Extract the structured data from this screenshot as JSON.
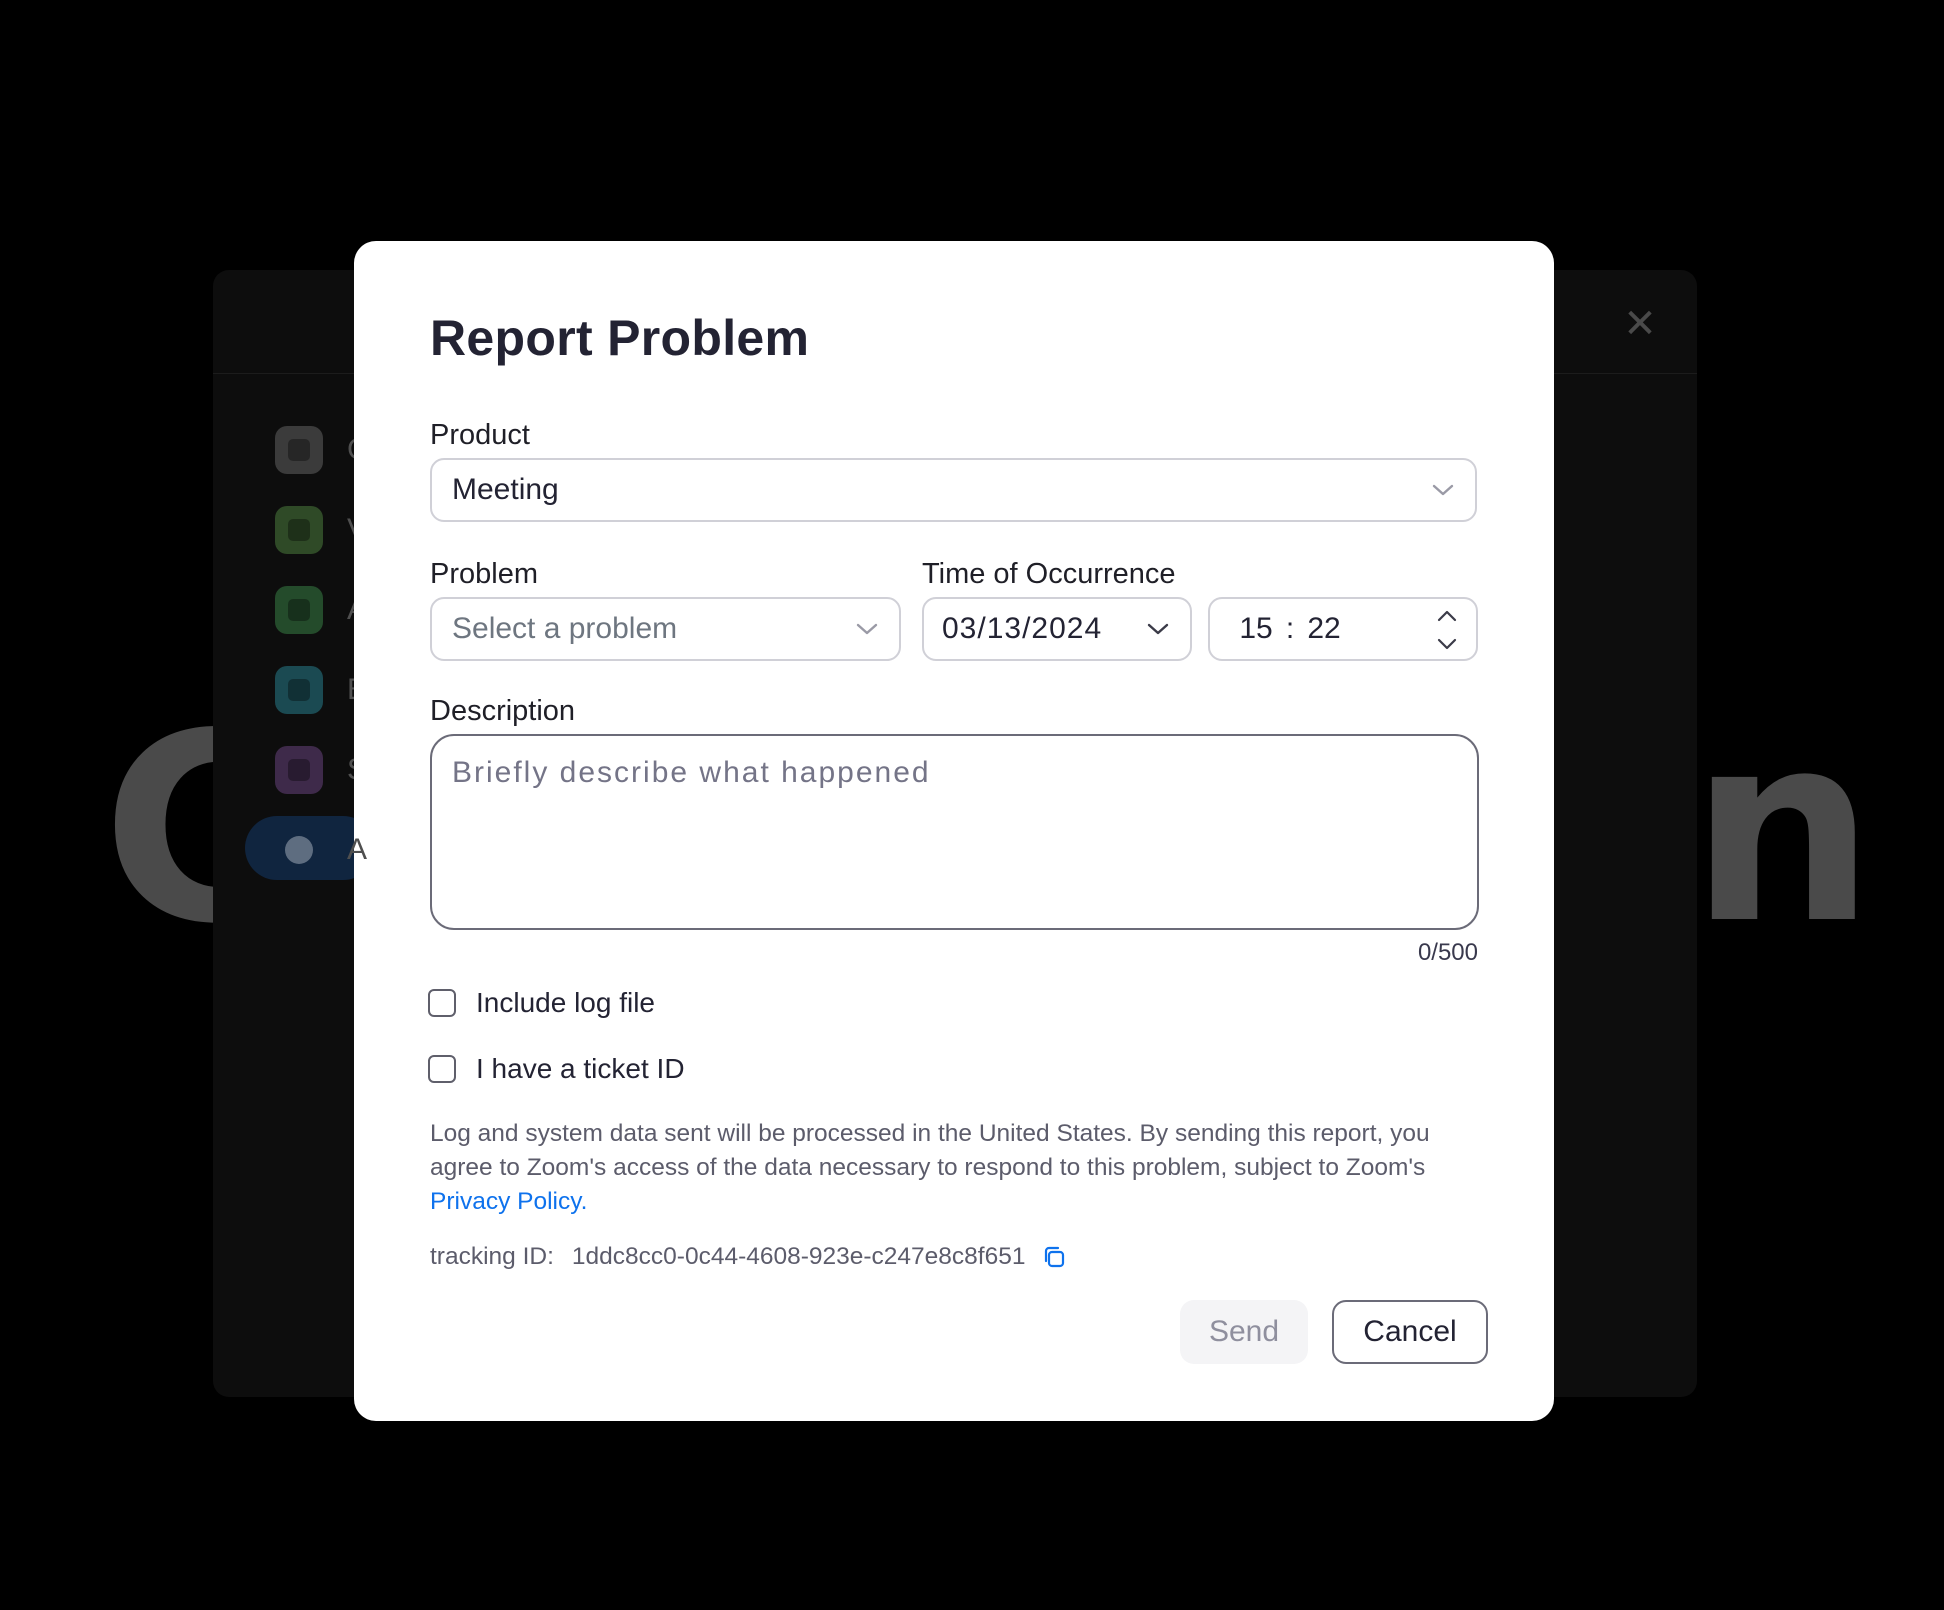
{
  "background": {
    "big_text_left": "C",
    "big_text_right": "n",
    "nav_items": [
      {
        "label": "G",
        "icon": "gear-icon",
        "color": "#3b3b3b"
      },
      {
        "label": "V",
        "icon": "video-icon",
        "color": "#2f4a27"
      },
      {
        "label": "A",
        "icon": "headphones-icon",
        "color": "#244b2b"
      },
      {
        "label": "B",
        "icon": "background-icon",
        "color": "#1b4a52"
      },
      {
        "label": "S",
        "icon": "statistics-icon",
        "color": "#3e2a4a"
      },
      {
        "label": "A",
        "icon": "info-icon",
        "color": "#10253f"
      }
    ],
    "close_icon": "close-icon"
  },
  "dialog": {
    "title": "Report Problem",
    "product": {
      "label": "Product",
      "value": "Meeting"
    },
    "problem": {
      "label": "Problem",
      "placeholder": "Select a problem"
    },
    "time_of_occurrence": {
      "label": "Time of Occurrence",
      "date": "03/13/2024",
      "hour": "15",
      "separator": ":",
      "minute": "22"
    },
    "description": {
      "label": "Description",
      "placeholder": "Briefly describe what happened",
      "value": "",
      "counter": "0/500"
    },
    "checkboxes": {
      "include_log": {
        "label": "Include log file",
        "checked": false
      },
      "ticket_id": {
        "label": "I have a ticket ID",
        "checked": false
      }
    },
    "notice": {
      "text": "Log and system data sent will be processed in the United States. By sending this report, you agree to Zoom's access of the data necessary to respond to this problem, subject to Zoom's ",
      "link": "Privacy Policy."
    },
    "tracking": {
      "label": "tracking ID:",
      "value": "1ddc8cc0-0c44-4608-923e-c247e8c8f651"
    },
    "buttons": {
      "send": "Send",
      "cancel": "Cancel"
    }
  },
  "colors": {
    "accent": "#0e72ed",
    "title_text": "#232333",
    "overlay": "#000000"
  }
}
